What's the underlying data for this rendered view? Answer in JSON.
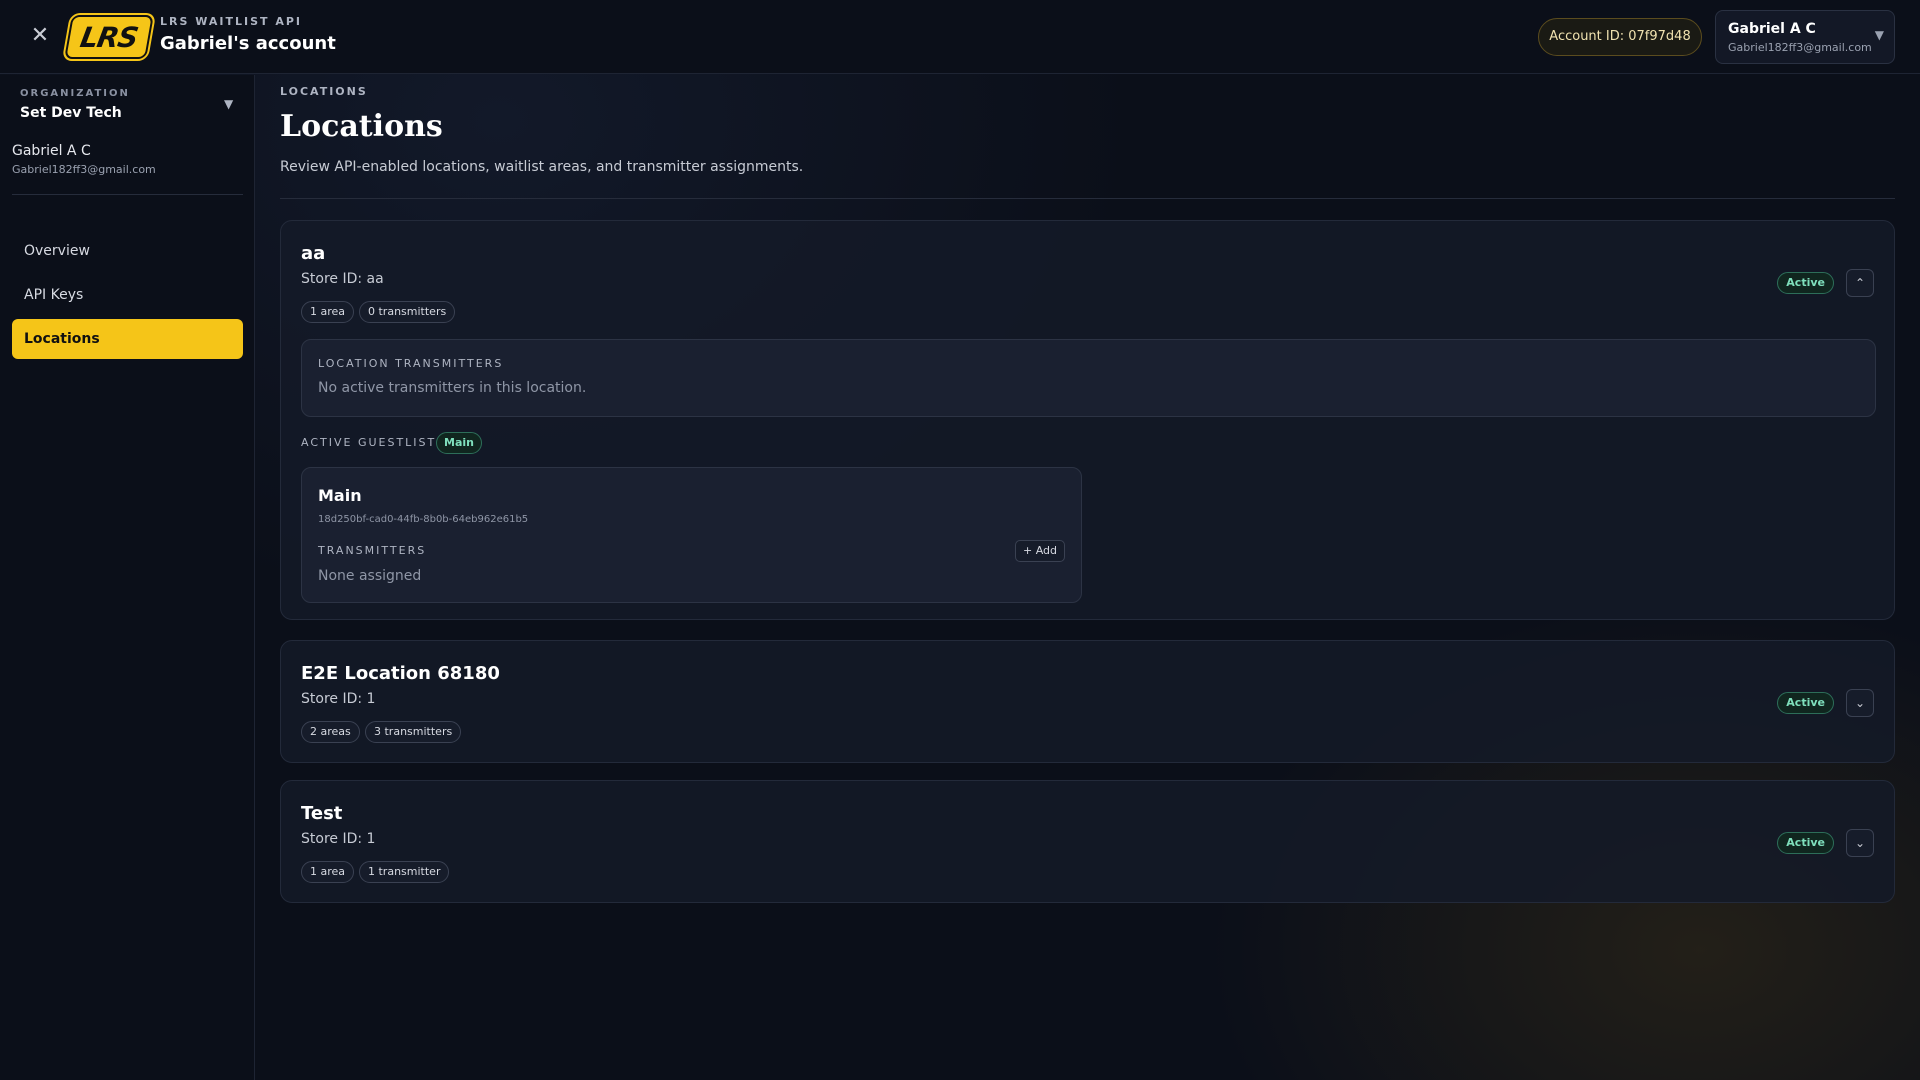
{
  "header": {
    "close_icon": "close-icon",
    "logo_text": "LRS",
    "app_subtitle": "LRS WAITLIST API",
    "account_title": "Gabriel's account",
    "account_id": "Account ID: 07f97d48",
    "user": {
      "name": "Gabriel A C",
      "email": "Gabriel182ff3@gmail.com",
      "caret": "▼"
    }
  },
  "sidebar": {
    "org_label": "ORGANIZATION",
    "org_name": "Set Dev Tech",
    "org_caret": "▼",
    "user_name": "Gabriel A C",
    "user_email": "Gabriel182ff3@gmail.com",
    "items": [
      {
        "label": "Overview",
        "active": false
      },
      {
        "label": "API Keys",
        "active": false
      },
      {
        "label": "Locations",
        "active": true
      }
    ]
  },
  "main": {
    "breadcrumb": "LOCATIONS",
    "title": "Locations",
    "description": "Review API-enabled locations, waitlist areas, and transmitter assignments.",
    "locations": [
      {
        "name": "aa",
        "store_id": "Store ID: aa",
        "chips": [
          "1 area",
          "0 transmitters"
        ],
        "status": "Active",
        "expanded": true,
        "toggle_glyph": "⌃",
        "location_transmitters_label": "LOCATION TRANSMITTERS",
        "location_transmitters_empty": "No active transmitters in this location.",
        "active_guestlist_label": "ACTIVE GUESTLIST",
        "active_guestlist_badge": "Main",
        "guestlist": {
          "name": "Main",
          "id": "18d250bf-cad0-44fb-8b0b-64eb962e61b5",
          "transmitters_label": "TRANSMITTERS",
          "add_label": "+ Add",
          "none_label": "None assigned"
        }
      },
      {
        "name": "E2E Location 68180",
        "store_id": "Store ID: 1",
        "chips": [
          "2 areas",
          "3 transmitters"
        ],
        "status": "Active",
        "expanded": false,
        "toggle_glyph": "⌄"
      },
      {
        "name": "Test",
        "store_id": "Store ID: 1",
        "chips": [
          "1 area",
          "1 transmitter"
        ],
        "status": "Active",
        "expanded": false,
        "toggle_glyph": "⌄"
      }
    ]
  },
  "colors": {
    "accent": "#f5c518",
    "background": "#0b0f19",
    "status_active": "#7fe0bd"
  }
}
